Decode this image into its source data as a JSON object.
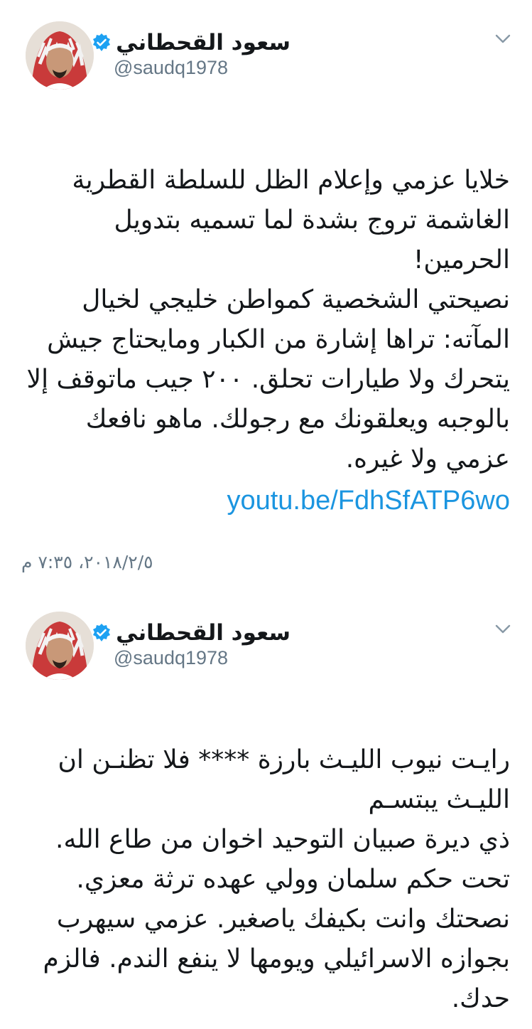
{
  "tweets": [
    {
      "author": {
        "name": "سعود القحطاني",
        "handle": "@saudq1978",
        "verified": true
      },
      "text": "خلايا عزمي وإعلام الظل للسلطة القطرية الغاشمة تروج بشدة لما تسميه بتدويل الحرمين!\nنصيحتي الشخصية كمواطن خليجي لخيال المآته: تراها إشارة من الكبار ومايحتاج جيش يتحرك ولا طيارات تحلق. ٢٠٠ جيب ماتوقف إلا بالوجبه ويعلقونك مع رجولك. ماهو نافعك عزمي ولا غيره.",
      "link": "youtu.be/FdhSfATP6wo",
      "timestamp": "٢٠١٨/٢/٥، ٧:٣٥ م"
    },
    {
      "author": {
        "name": "سعود القحطاني",
        "handle": "@saudq1978",
        "verified": true
      },
      "text": "رايـت نيوب الليـث بارزة **** فلا تظنـن ان الليـث يبتسـم\nذي ديرة صبيان التوحيد اخوان من طاع الله.\nتحت حكم سلمان وولي عهده ترثة معزي.\nنصحتك وانت بكيفك ياصغير.  عزمي سيهرب بجوازه الاسرائيلي ويومها لا ينفع الندم. فالزم حدك."
    }
  ],
  "colors": {
    "accent_link": "#1b95e0",
    "verified_badge": "#1da1f2",
    "secondary_text": "#657786"
  },
  "icons": {
    "verified": "verified-badge-icon",
    "menu": "chevron-down-icon"
  }
}
